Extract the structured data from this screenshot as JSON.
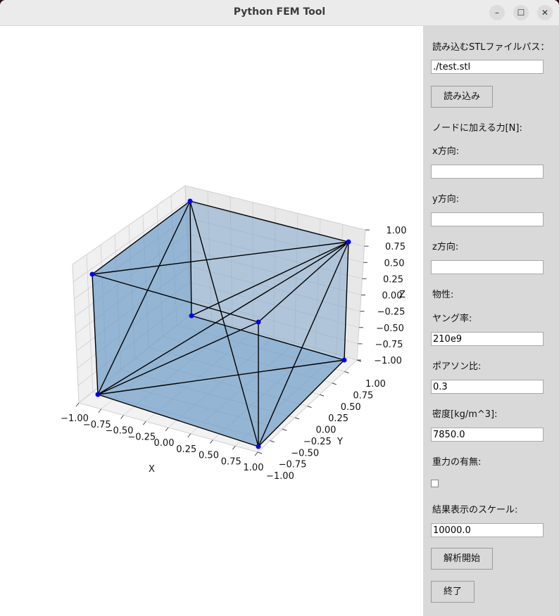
{
  "window": {
    "title": "Python FEM Tool",
    "minimize": "–",
    "maximize": "☐",
    "close": "✕"
  },
  "plot": {
    "axis_labels": {
      "x": "X",
      "y": "Y",
      "z": "Z"
    },
    "x_ticks": [
      "−1.00",
      "−0.75",
      "−0.50",
      "−0.25",
      "0.00",
      "0.25",
      "0.50",
      "0.75",
      "1.00"
    ],
    "y_ticks": [
      "−1.00",
      "−0.75",
      "−0.50",
      "−0.25",
      "0.00",
      "0.25",
      "0.50",
      "0.75",
      "1.00"
    ],
    "z_ticks": [
      "−1.00",
      "−0.75",
      "−0.50",
      "−0.25",
      "0.00",
      "0.25",
      "0.50",
      "0.75",
      "1.00"
    ],
    "mesh_color": "#5b8fbf",
    "node_color": "#0000ee"
  },
  "panel": {
    "stl_path_label": "読み込むSTLファイルパス：",
    "stl_path_value": "./test.stl",
    "load_button": "読み込み",
    "force_label": "ノードに加える力[N]:",
    "fx_label": "x方向:",
    "fx_value": "",
    "fy_label": "y方向:",
    "fy_value": "",
    "fz_label": "z方向:",
    "fz_value": "",
    "material_label": "物性:",
    "young_label": "ヤング率:",
    "young_value": "210e9",
    "poisson_label": "ポアソン比:",
    "poisson_value": "0.3",
    "density_label": "密度[kg/m^3]:",
    "density_value": "7850.0",
    "gravity_label": "重力の有無:",
    "gravity_checked": false,
    "scale_label": "結果表示のスケール:",
    "scale_value": "10000.0",
    "start_button": "解析開始",
    "quit_button": "終了"
  }
}
